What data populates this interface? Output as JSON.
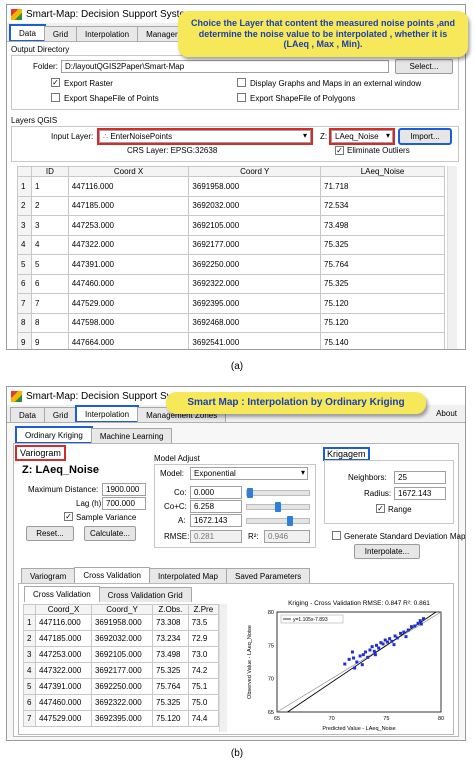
{
  "figure_a": {
    "window_title": "Smart-Map: Decision Support Syste",
    "tabs": [
      "Data",
      "Grid",
      "Interpolation",
      "Manager"
    ],
    "output_directory_label": "Output Directory",
    "folder_label": "Folder:",
    "folder_value": "D:/layoutQGIS2Paper\\Smart-Map",
    "select_button": "Select...",
    "export_raster": "Export Raster",
    "export_points": "Export ShapeFile of Points",
    "display_external": "Display Graphs and Maps in an external window",
    "export_polygons": "Export ShapeFile of Polygons",
    "layers_qgis_label": "Layers QGIS",
    "input_layer_label": "Input Layer:",
    "input_layer_value": "EnterNoisePoints",
    "crs_label": "CRS Layer: EPSG:32638",
    "z_label": "Z:",
    "z_value": "LAeq_Noise",
    "import_button": "Import...",
    "eliminate_outliers": "Eliminate Outliers",
    "columns": [
      "ID",
      "Coord X",
      "Coord Y",
      "LAeq_Noise"
    ],
    "rows": [
      [
        "1",
        "1",
        "447116.000",
        "3691958.000",
        "71.718"
      ],
      [
        "2",
        "2",
        "447185.000",
        "3692032.000",
        "72.534"
      ],
      [
        "3",
        "3",
        "447253.000",
        "3692105.000",
        "73.498"
      ],
      [
        "4",
        "4",
        "447322.000",
        "3692177.000",
        "75.325"
      ],
      [
        "5",
        "5",
        "447391.000",
        "3692250.000",
        "75.764"
      ],
      [
        "6",
        "6",
        "447460.000",
        "3692322.000",
        "75.325"
      ],
      [
        "7",
        "7",
        "447529.000",
        "3692395.000",
        "75.120"
      ],
      [
        "8",
        "8",
        "447598.000",
        "3692468.000",
        "75.120"
      ],
      [
        "9",
        "9",
        "447664.000",
        "3692541.000",
        "75.140"
      ]
    ],
    "callout": "Choice the Layer that content the measured noise points ,and determine the noise value to be interpolated , whether it is (LAeq , Max , Min).",
    "caption": "(a)"
  },
  "figure_b": {
    "window_title": "Smart-Map: Decision Support Sys",
    "tabs": [
      "Data",
      "Grid",
      "Interpolation",
      "Management Zones"
    ],
    "about": "About",
    "subtabs": [
      "Ordinary Kriging",
      "Machine Learning"
    ],
    "variogram_label": "Variogram",
    "z_title": "Z: LAeq_Noise",
    "max_distance_label": "Maximum Distance:",
    "max_distance_value": "1900.000",
    "lag_label": "Lag (h):",
    "lag_value": "700.000",
    "sample_variance": "Sample Variance",
    "reset_button": "Reset...",
    "calculate_button": "Calculate...",
    "model_adjust_label": "Model Adjust",
    "model_label": "Model:",
    "model_value": "Exponential",
    "c0_label": "Co:",
    "c0_value": "0.000",
    "c0c_label": "Co+C:",
    "c0c_value": "6.258",
    "a_label": "A:",
    "a_value": "1672.143",
    "rmse_label": "RMSE:",
    "rmse_value": "0.281",
    "r2_label": "R²:",
    "r2_value": "0.946",
    "krigagem_label": "Krigagem",
    "neighbors_label": "Neighbors:",
    "neighbors_value": "25",
    "radius_label": "Radius:",
    "radius_value": "1672.143",
    "range_label": "Range",
    "std_dev_map": "Generate Standard Deviation Map",
    "interpolate_button": "Interpolate...",
    "bottom_tabs": [
      "Variogram",
      "Cross Validation",
      "Interpolated Map",
      "Saved Parameters"
    ],
    "cv_subtabs": [
      "Cross Validation",
      "Cross Validation Grid"
    ],
    "cv_columns": [
      "Coord_X",
      "Coord_Y",
      "Z.Obs.",
      "Z.Pre"
    ],
    "cv_rows": [
      [
        "1",
        "447116.000",
        "3691958.000",
        "73.308",
        "73.5"
      ],
      [
        "2",
        "447185.000",
        "3692032.000",
        "73.234",
        "72.9"
      ],
      [
        "3",
        "447253.000",
        "3692105.000",
        "73.498",
        "73.0"
      ],
      [
        "4",
        "447322.000",
        "3692177.000",
        "75.325",
        "74.2"
      ],
      [
        "5",
        "447391.000",
        "3692250.000",
        "75.764",
        "75.1"
      ],
      [
        "6",
        "447460.000",
        "3692322.000",
        "75.325",
        "75.0"
      ],
      [
        "7",
        "447529.000",
        "3692395.000",
        "75.120",
        "74.4"
      ]
    ],
    "callout": "Smart Map : Interpolation by Ordinary Kriging",
    "caption": "(b)"
  },
  "chart_data": {
    "type": "scatter",
    "title": "Kriging - Cross Validation  RMSE: 0.847  R²: 0.861",
    "legend": "y=1.105x-7.893",
    "xlabel": "Predicted Value - LAeq_Noise",
    "ylabel": "Observed Value - LAeq_Noise",
    "xlim": [
      65,
      80
    ],
    "ylim": [
      65,
      80
    ],
    "xticks": [
      65,
      70,
      75,
      80
    ],
    "yticks": [
      65,
      70,
      75,
      80
    ],
    "points": [
      [
        71.2,
        72.2
      ],
      [
        71.6,
        72.9
      ],
      [
        72.0,
        73.1
      ],
      [
        72.3,
        72.5
      ],
      [
        72.6,
        73.4
      ],
      [
        72.9,
        73.6
      ],
      [
        73.1,
        74.0
      ],
      [
        73.3,
        73.2
      ],
      [
        73.5,
        74.3
      ],
      [
        73.7,
        74.8
      ],
      [
        73.9,
        74.1
      ],
      [
        74.1,
        75.0
      ],
      [
        74.3,
        74.6
      ],
      [
        74.5,
        75.4
      ],
      [
        74.7,
        75.2
      ],
      [
        74.9,
        75.8
      ],
      [
        75.1,
        75.5
      ],
      [
        75.3,
        76.0
      ],
      [
        75.5,
        75.6
      ],
      [
        75.8,
        76.4
      ],
      [
        76.0,
        76.1
      ],
      [
        76.3,
        76.8
      ],
      [
        76.6,
        77.0
      ],
      [
        77.0,
        77.3
      ],
      [
        77.3,
        77.8
      ],
      [
        77.6,
        77.9
      ],
      [
        77.9,
        78.3
      ],
      [
        78.1,
        78.7
      ],
      [
        78.2,
        78.2
      ],
      [
        78.4,
        79.0
      ],
      [
        72.1,
        71.6
      ],
      [
        72.8,
        72.1
      ],
      [
        74.0,
        73.6
      ],
      [
        75.7,
        75.1
      ],
      [
        76.8,
        76.3
      ],
      [
        71.9,
        74.0
      ]
    ],
    "fit_line": {
      "slope": 1.105,
      "intercept": -7.893
    },
    "identity_line": true,
    "point_color": "#1f2fd0"
  }
}
